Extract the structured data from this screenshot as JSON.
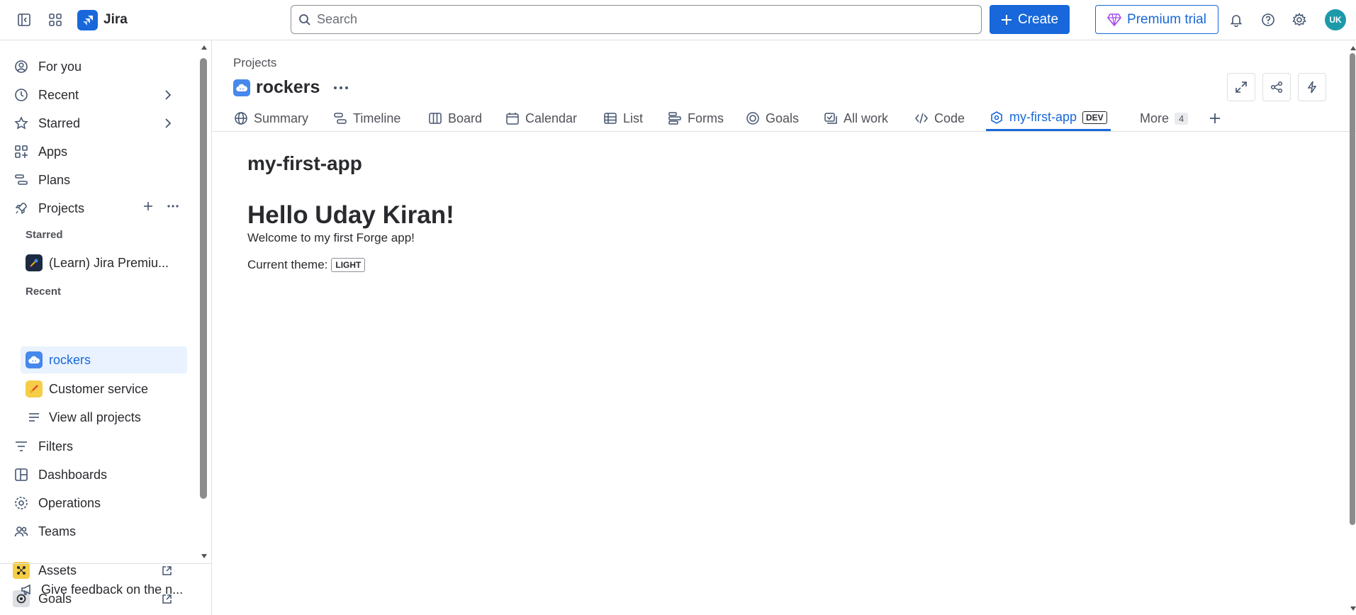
{
  "topbar": {
    "app_name": "Jira",
    "search_placeholder": "Search",
    "create_label": "Create",
    "premium_label": "Premium trial",
    "avatar_initials": "UK",
    "colors": {
      "accent": "#1868db",
      "avatar": "#1d9aaa"
    }
  },
  "sidebar": {
    "items_top": [
      {
        "label": "For you",
        "icon": "user-circle-icon"
      },
      {
        "label": "Recent",
        "icon": "clock-icon"
      },
      {
        "label": "Starred",
        "icon": "star-icon"
      },
      {
        "label": "Apps",
        "icon": "apps-icon"
      },
      {
        "label": "Plans",
        "icon": "plans-icon"
      },
      {
        "label": "Projects",
        "icon": "rocket-icon"
      }
    ],
    "starred_heading": "Starred",
    "starred_projects": [
      {
        "label": "(Learn) Jira Premiu...",
        "icon": "rocket-project-icon"
      }
    ],
    "recent_heading": "Recent",
    "recent_projects": [
      {
        "label": "rockers",
        "icon": "cloud-project-icon"
      },
      {
        "label": "Customer service",
        "icon": "customer-service-icon"
      }
    ],
    "view_all": "View all projects",
    "items_bottom": [
      {
        "label": "Filters",
        "icon": "filter-icon"
      },
      {
        "label": "Dashboards",
        "icon": "dashboard-icon"
      },
      {
        "label": "Operations",
        "icon": "operations-icon"
      },
      {
        "label": "Teams",
        "icon": "teams-icon"
      },
      {
        "label": "Assets",
        "icon": "assets-icon"
      },
      {
        "label": "Goals",
        "icon": "goals-icon"
      }
    ],
    "feedback": "Give feedback on the n..."
  },
  "main": {
    "breadcrumb": "Projects",
    "project_name": "rockers",
    "tabs": [
      {
        "label": "Summary",
        "icon": "globe-icon"
      },
      {
        "label": "Timeline",
        "icon": "timeline-icon"
      },
      {
        "label": "Board",
        "icon": "board-icon"
      },
      {
        "label": "Calendar",
        "icon": "calendar-icon"
      },
      {
        "label": "List",
        "icon": "list-icon"
      },
      {
        "label": "Forms",
        "icon": "forms-icon"
      },
      {
        "label": "Goals",
        "icon": "goal-icon"
      },
      {
        "label": "All work",
        "icon": "all-work-icon"
      },
      {
        "label": "Code",
        "icon": "code-icon"
      },
      {
        "label": "my-first-app",
        "icon": "app-icon",
        "badge": "DEV",
        "active": true
      },
      {
        "label": "More",
        "badge": "4"
      }
    ],
    "app_title": "my-first-app",
    "hello": "Hello Uday Kiran!",
    "welcome": "Welcome to my first Forge app!",
    "theme_label": "Current theme:",
    "theme_value": "LIGHT"
  }
}
